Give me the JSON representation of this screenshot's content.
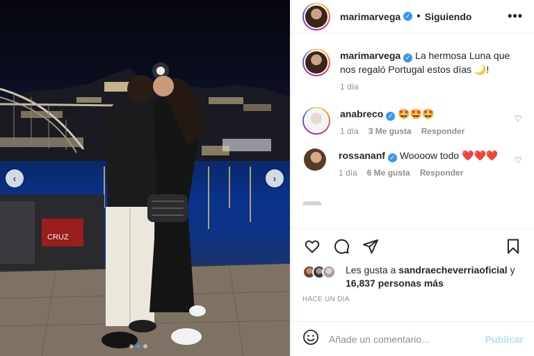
{
  "post": {
    "author": "marimarvega",
    "follow_status": "Siguiendo",
    "separator": "•",
    "more_icon": "more-horizontal-icon",
    "caption": {
      "username": "marimarvega",
      "text": "La hermosa Luna que nos regaló Portugal estos días 🌙!",
      "time": "1 día"
    },
    "comments": [
      {
        "username": "anabreco",
        "text": "🤩🤩🤩",
        "time": "1 día",
        "likes": "3 Me gusta",
        "reply": "Responder"
      },
      {
        "username": "rossananf",
        "text": "Woooow todo ❤️❤️❤️",
        "time": "1 día",
        "likes": "6 Me gusta",
        "reply": "Responder"
      }
    ],
    "liked_by_prefix": "Les gusta a",
    "liked_by_user": "sandraecheverriaoficial",
    "liked_by_and": "y",
    "liked_by_others": "16,837 personas más",
    "posted": "HACE UN DÍA",
    "add_comment_placeholder": "Añade un comentario...",
    "publish_label": "Publicar"
  },
  "carousel": {
    "prev": "‹",
    "next": "›",
    "dot_count": 3,
    "active_dot": 1
  },
  "colors": {
    "verified": "#3897f0",
    "publish_disabled": "#b2dffc",
    "muted_text": "#8e8e8e"
  }
}
